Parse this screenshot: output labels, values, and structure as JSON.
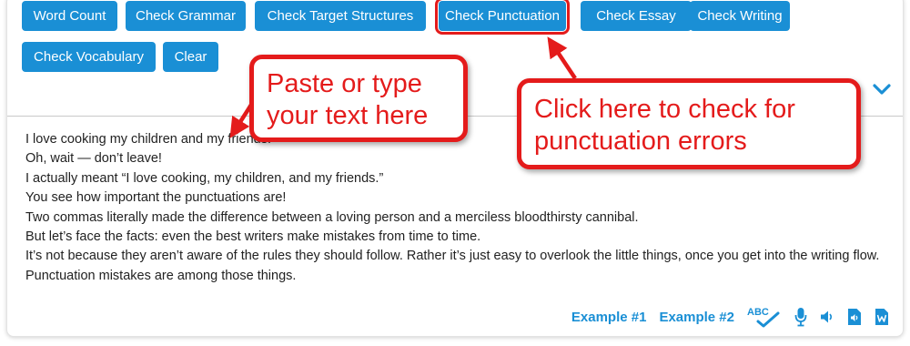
{
  "toolbar": {
    "buttons": [
      "Word Count",
      "Check Grammar",
      "Check Target Structures",
      "Check Punctuation",
      "Check Essay",
      "Check Writing",
      "Check Vocabulary",
      "Clear"
    ]
  },
  "editor": {
    "lines": [
      "I love cooking my children and my friends.",
      "Oh, wait — don’t leave!",
      "I actually meant “I love cooking, my children, and my friends.”",
      "You see how important the punctuations are!",
      "Two commas literally made the difference between a loving person and a merciless bloodthirsty cannibal.",
      "But let’s face the facts: even the best writers make mistakes from time to time.",
      "It’s not because they aren’t aware of the rules they should follow. Rather it’s just easy to overlook the little things, once you get into the writing flow.",
      "Punctuation mistakes are among those things."
    ]
  },
  "footer": {
    "example1": "Example #1",
    "example2": "Example #2",
    "spellcheck_text": "ABC"
  },
  "callouts": {
    "paste": [
      "Paste or type",
      "your text here"
    ],
    "punctuation": [
      "Click here to check for",
      "punctuation errors"
    ]
  },
  "colors": {
    "accent": "#1a8fd5",
    "callout": "#e41b1b"
  },
  "icons": [
    "chevron-down-icon",
    "spellcheck-icon",
    "microphone-icon",
    "speaker-icon",
    "audio-file-icon",
    "word-file-icon"
  ]
}
